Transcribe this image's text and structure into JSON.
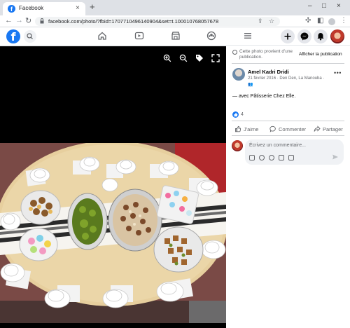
{
  "browser": {
    "tab_title": "Facebook",
    "url": "facebook.com/photo/?fbid=1707710496140904&set=t.100010768057678",
    "new_tab": "+",
    "tab_close": "×",
    "window_controls": [
      "–",
      "□",
      "×"
    ]
  },
  "fb": {
    "logo": "f"
  },
  "panel": {
    "notice": "Cette photo provient d'une publication.",
    "show_publication": "Afficher la publication",
    "author": "Amel Kadri Dridi",
    "meta_line1": "21 février 2016 · Den Den, La Manouba ·",
    "meta_line2": "👥",
    "caption": "— avec Pâtisserie Chez Elle.",
    "reaction_count": "4",
    "actions": {
      "like": "J'aime",
      "comment": "Commenter",
      "share": "Partager"
    },
    "comment_placeholder": "Écrivez un commentaire..."
  },
  "colors": {
    "brand": "#1877f2",
    "tablecloth": "#e7cf9e",
    "photo_bg": "#000000"
  }
}
